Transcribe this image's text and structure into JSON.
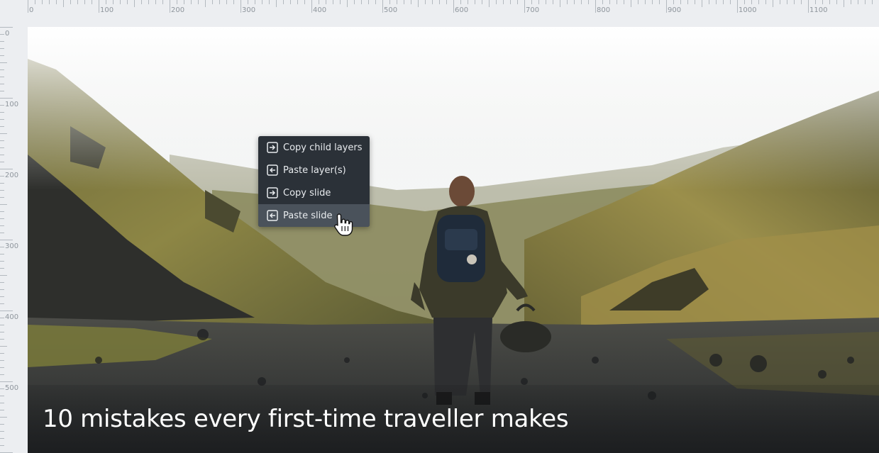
{
  "ruler": {
    "top_labels": [
      "0",
      "100",
      "200",
      "300",
      "400",
      "500",
      "600",
      "700",
      "800",
      "900",
      "1000",
      "1100"
    ],
    "left_labels": [
      "0",
      "100",
      "200",
      "300",
      "400",
      "500"
    ]
  },
  "slide": {
    "caption": "10 mistakes every first-time traveller makes"
  },
  "context_menu": {
    "items": [
      {
        "label": "Copy child layers",
        "icon": "copy-arrow-icon"
      },
      {
        "label": "Paste layer(s)",
        "icon": "paste-arrow-icon"
      },
      {
        "label": "Copy slide",
        "icon": "copy-arrow-icon"
      },
      {
        "label": "Paste slide",
        "icon": "paste-arrow-icon"
      }
    ],
    "hovered_index": 3
  },
  "colors": {
    "menu_bg": "#2b3138",
    "menu_hover": "#4a525b",
    "ruler_bg": "#eceef1"
  }
}
